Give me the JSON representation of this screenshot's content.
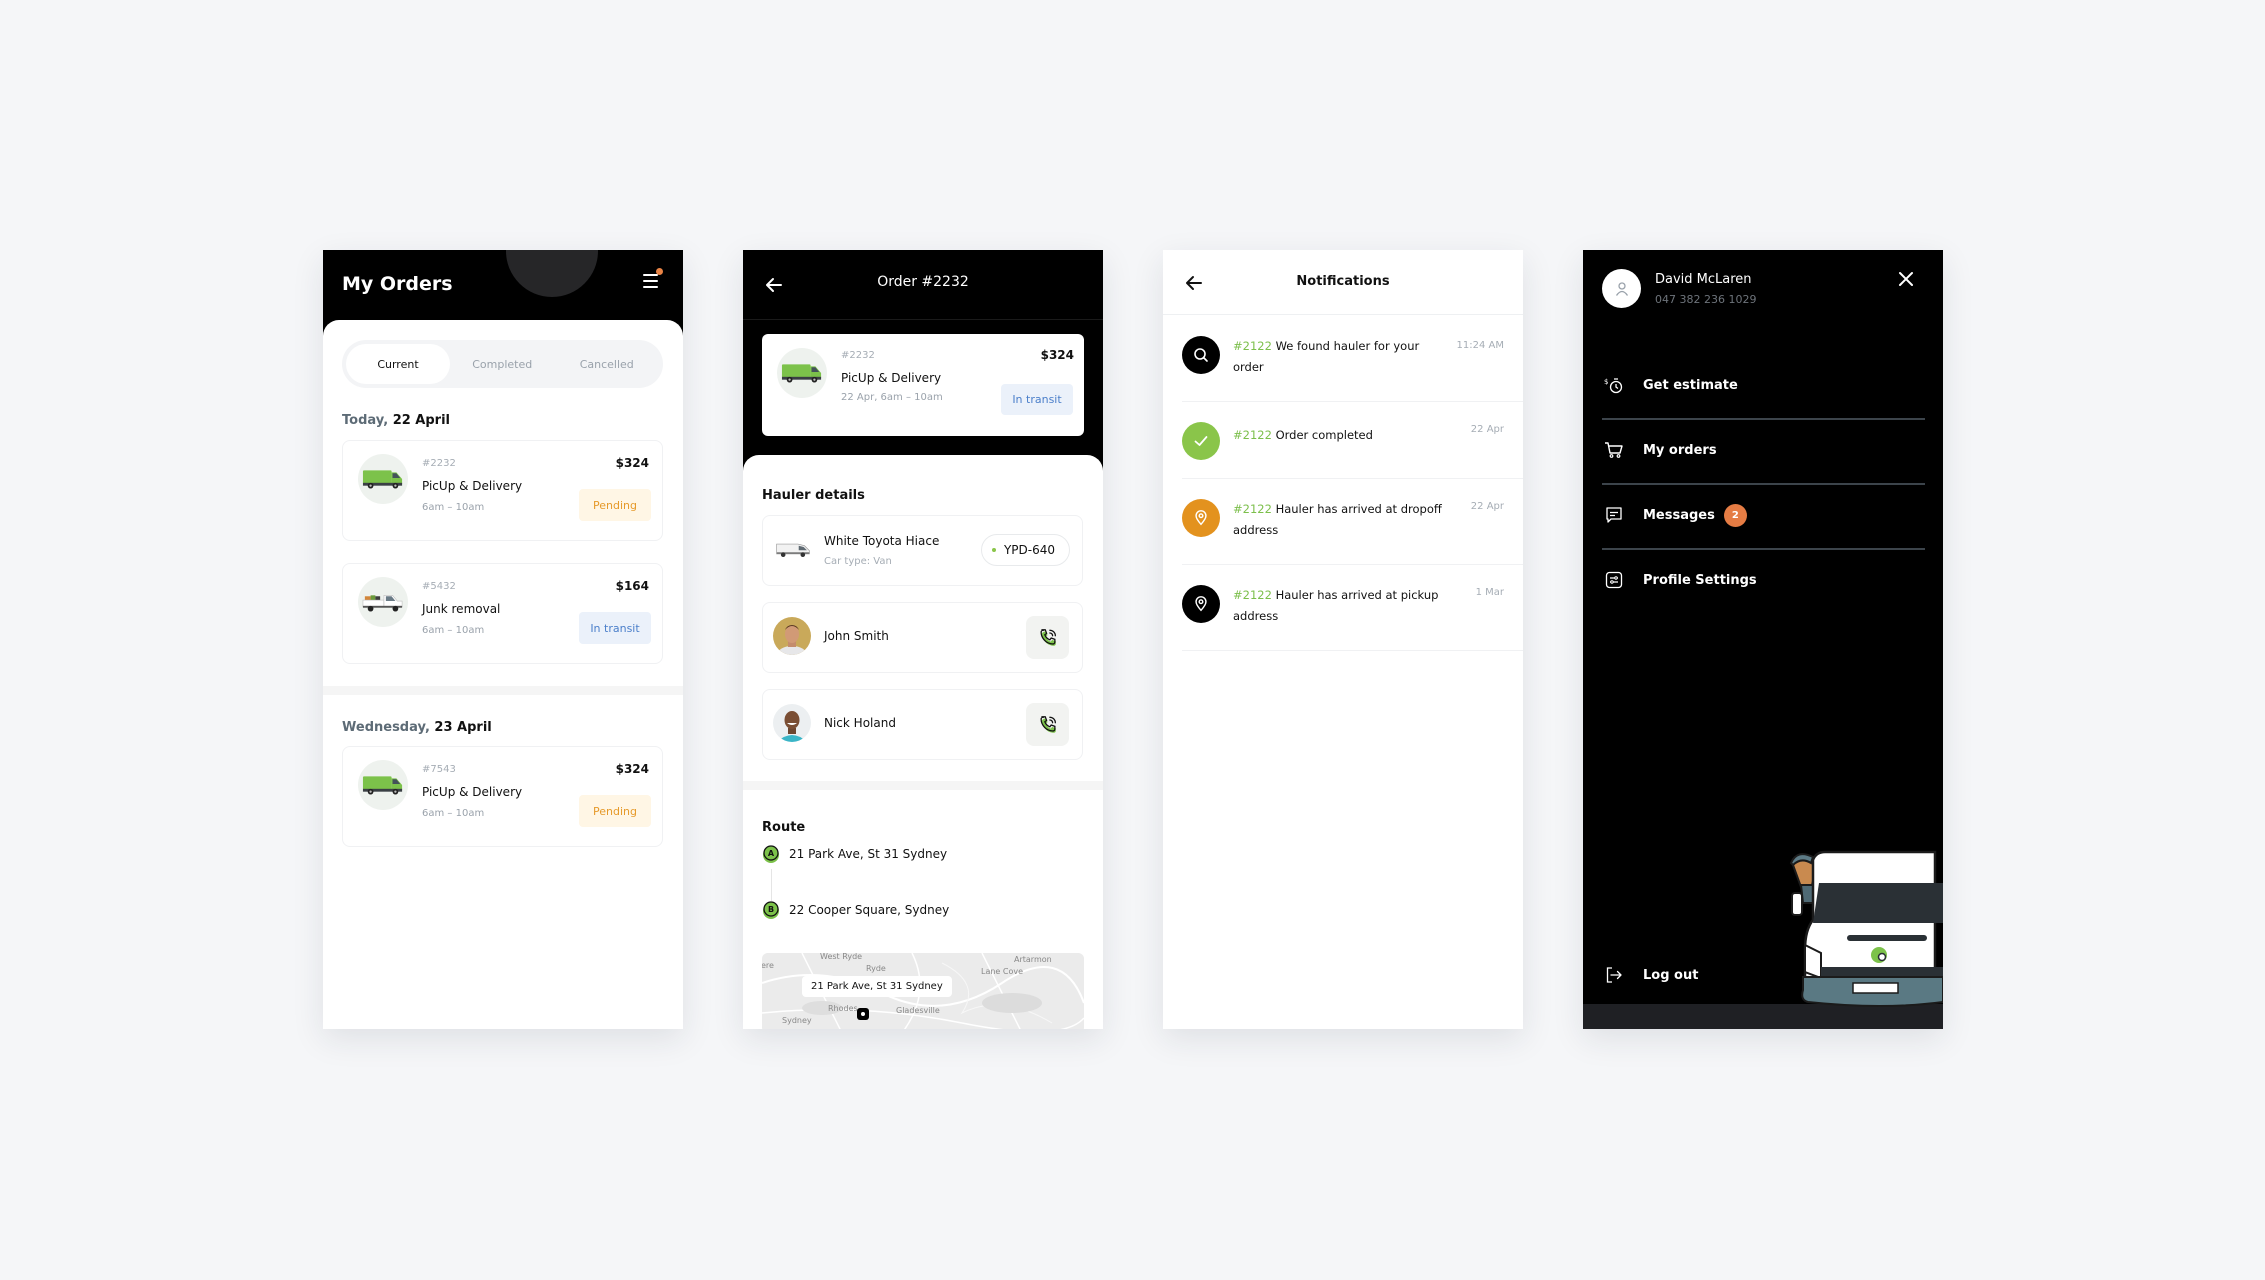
{
  "colors": {
    "accent_green": "#8ac54a",
    "pending": "#e69a2a",
    "transit": "#4b7fca",
    "badge_orange": "#e57c44",
    "notif_orange": "#e3921e"
  },
  "screen1": {
    "title": "My Orders",
    "menu_icon": "hamburger-menu-icon",
    "tabs": [
      {
        "label": "Current",
        "active": true
      },
      {
        "label": "Completed",
        "active": false
      },
      {
        "label": "Cancelled",
        "active": false
      }
    ],
    "groups": [
      {
        "day": "Today,",
        "date": "22 April",
        "orders": [
          {
            "id": "#2232",
            "title": "PicUp & Delivery",
            "time": "6am – 10am",
            "price": "$324",
            "status": "Pending",
            "vehicle": "green-van-icon"
          },
          {
            "id": "#5432",
            "title": "Junk removal",
            "time": "6am – 10am",
            "price": "$164",
            "status": "In transit",
            "vehicle": "white-pickup-truck-icon"
          }
        ]
      },
      {
        "day": "Wednesday,",
        "date": "23 April",
        "orders": [
          {
            "id": "#7543",
            "title": "PicUp & Delivery",
            "time": "6am – 10am",
            "price": "$324",
            "status": "Pending",
            "vehicle": "green-van-icon"
          }
        ]
      }
    ]
  },
  "screen2": {
    "title": "Order #2232",
    "order": {
      "id": "#2232",
      "title": "PicUp & Delivery",
      "time": "22 Apr, 6am – 10am",
      "price": "$324",
      "status": "In transit"
    },
    "hauler_heading": "Hauler details",
    "vehicle": {
      "name": "White Toyota Hiace",
      "type": "Car type: Van",
      "plate": "YPD-640"
    },
    "people": [
      {
        "name": "John Smith"
      },
      {
        "name": "Nick Holand"
      }
    ],
    "route_heading": "Route",
    "route": [
      {
        "marker": "A",
        "address": "21 Park Ave, St 31 Sydney"
      },
      {
        "marker": "B",
        "address": "22 Cooper Square, Sydney"
      }
    ],
    "map": {
      "tooltip": "21 Park Ave, St 31 Sydney",
      "labels": [
        "West Ryde",
        "Ryde",
        "Artarmon",
        "Lane Cove",
        "Rhodes",
        "Gladesville",
        "Sydney",
        "ere"
      ]
    }
  },
  "screen3": {
    "title": "Notifications",
    "items": [
      {
        "icon": "search-icon",
        "order": "#2122",
        "text": "We found hauler for your order",
        "time": "11:24 AM"
      },
      {
        "icon": "check-icon",
        "order": "#2122",
        "text": "Order completed",
        "time": "22 Apr"
      },
      {
        "icon": "location-pin-icon",
        "order": "#2122",
        "text": "Hauler has arrived at dropoff address",
        "time": "22 Apr"
      },
      {
        "icon": "location-pin-icon",
        "order": "#2122",
        "text": "Hauler has arrived at pickup address",
        "time": "1 Mar"
      }
    ]
  },
  "screen4": {
    "user": {
      "name": "David McLaren",
      "phone": "047 382 236 1029"
    },
    "menu": [
      {
        "label": "Get estimate",
        "icon": "estimate-timer-icon"
      },
      {
        "label": "My orders",
        "icon": "cart-icon"
      },
      {
        "label": "Messages",
        "icon": "message-icon",
        "badge": "2"
      },
      {
        "label": "Profile Settings",
        "icon": "settings-sliders-icon"
      }
    ],
    "logout": "Log out"
  }
}
